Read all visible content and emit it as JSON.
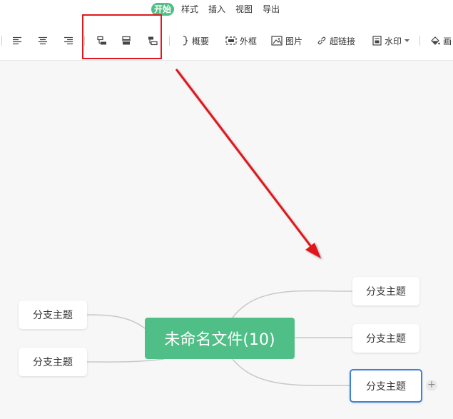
{
  "menu": {
    "tabs": [
      {
        "label": "开始",
        "active": true
      },
      {
        "label": "样式",
        "active": false
      },
      {
        "label": "插入",
        "active": false
      },
      {
        "label": "视图",
        "active": false
      },
      {
        "label": "导出",
        "active": false
      }
    ]
  },
  "toolbar": {
    "align_left_icon": "align-left-icon",
    "align_center_icon": "align-center-icon",
    "align_right_icon": "align-right-icon",
    "layout_left_icon": "layout-left-icon",
    "layout_center_icon": "layout-center-icon",
    "layout_right_icon": "layout-right-icon",
    "summary_label": "概要",
    "frame_label": "外框",
    "image_label": "图片",
    "hyperlink_label": "超链接",
    "watermark_label": "水印",
    "paint_label": "画"
  },
  "mindmap": {
    "root_label": "未命名文件(10)",
    "left_branches": [
      "分支主题",
      "分支主题"
    ],
    "right_branches": [
      "分支主题",
      "分支主题",
      "分支主题"
    ],
    "add_button": "+"
  },
  "colors": {
    "accent": "#4fbf87",
    "highlight": "#e0191e",
    "selection": "#3c82d8"
  }
}
